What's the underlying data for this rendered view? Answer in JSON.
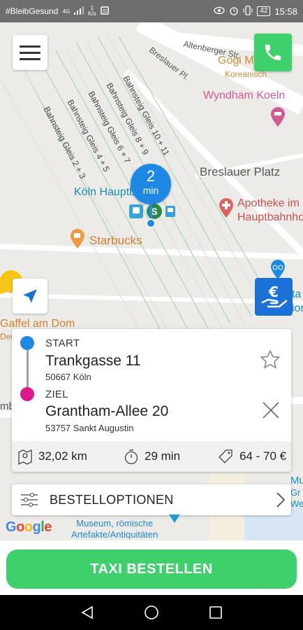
{
  "status_bar": {
    "left_text": "#BleibGesund",
    "network": "4G",
    "speed_value": "1",
    "speed_unit": "K/s",
    "battery": "42",
    "time": "15:58"
  },
  "map": {
    "street_altenberger": "Altenberger Str.",
    "street_breslauer_pl": "Breslauer Pl.",
    "gogi_name": "Gogi M",
    "gogi_type": "Koreanisch",
    "wyndham": "Wyndham Koeln",
    "tracks": [
      "Bahnsteig Gleis 2 + 3",
      "Bahnsteig Gleis 4 + 5",
      "Bahnsteig Gleis 6 + 7",
      "Bahnsteig Gleis 8 + 9",
      "Bahnsteig Gleis 10 + 11"
    ],
    "station": "Köln Hauptbahnhof",
    "breslauer_platz": "Breslauer Platz",
    "apotheke_line1": "Apotheke im",
    "apotheke_line2": "Hauptbahnho",
    "starbucks": "Starbucks",
    "gaffel": "Gaffel am Dom",
    "gaffel_sub": "Deu",
    "right_edge_1": "ta",
    "right_edge_2": "ior",
    "left_edge": "mb",
    "br_mu": "Mu",
    "br_gr": "Gr",
    "br_we": "We",
    "museum_line1": "Museum, römische",
    "museum_line2": "Artefakte/Antiquitäten",
    "google": "Google",
    "eta_value": "2",
    "eta_unit": "min"
  },
  "trip": {
    "start_label": "START",
    "start_street": "Trankgasse 11",
    "start_city": "50667  Köln",
    "dest_label": "ZIEL",
    "dest_street": "Grantham-Allee 20",
    "dest_city": "53757  Sankt Augustin",
    "distance": "32,02 km",
    "duration": "29 min",
    "price": "64 - 70 €"
  },
  "options_label": "BESTELLOPTIONEN",
  "order_button": "TAXI BESTELLEN",
  "colors": {
    "green": "#3dd06b",
    "blue": "#1e88e5",
    "magenta": "#e0188c"
  }
}
